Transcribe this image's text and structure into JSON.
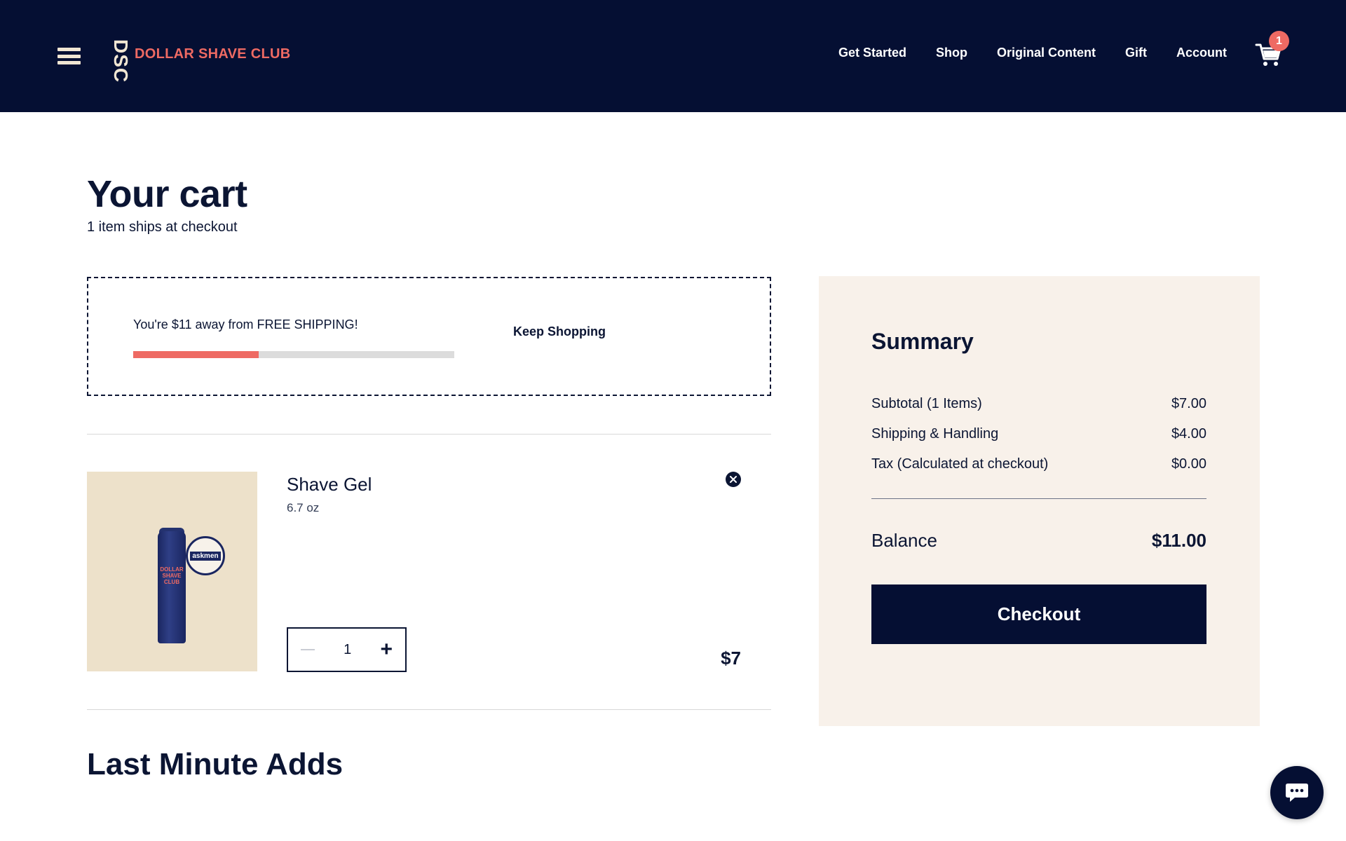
{
  "header": {
    "logo_mark": "DSC",
    "logo_text": "DOLLAR SHAVE CLUB",
    "nav": [
      "Get Started",
      "Shop",
      "Original Content",
      "Gift",
      "Account"
    ],
    "cart_count": "1"
  },
  "cart": {
    "title": "Your cart",
    "subtitle": "1 item ships at checkout",
    "shipping_message": "You're $11 away from FREE SHIPPING!",
    "shipping_progress": 0.39,
    "keep_shopping": "Keep Shopping",
    "item": {
      "name": "Shave Gel",
      "size": "6.7 oz",
      "quantity": "1",
      "price": "$7",
      "image_label": "DOLLAR SHAVE CLUB",
      "badge_text": "askmen"
    },
    "last_minute_title": "Last Minute Adds"
  },
  "summary": {
    "title": "Summary",
    "rows": [
      {
        "label": "Subtotal (1 Items)",
        "value": "$7.00"
      },
      {
        "label": "Shipping & Handling",
        "value": "$4.00"
      },
      {
        "label": "Tax (Calculated at checkout)",
        "value": "$0.00"
      }
    ],
    "balance_label": "Balance",
    "balance_value": "$11.00",
    "checkout_label": "Checkout"
  },
  "icons": {
    "menu": "hamburger-icon",
    "cart": "cart-icon",
    "remove": "close-circle-icon",
    "chat": "chat-bubble-icon"
  },
  "colors": {
    "navy": "#050f33",
    "coral": "#ee6a63",
    "cream": "#f8f1ea",
    "beige": "#ede1ca"
  }
}
